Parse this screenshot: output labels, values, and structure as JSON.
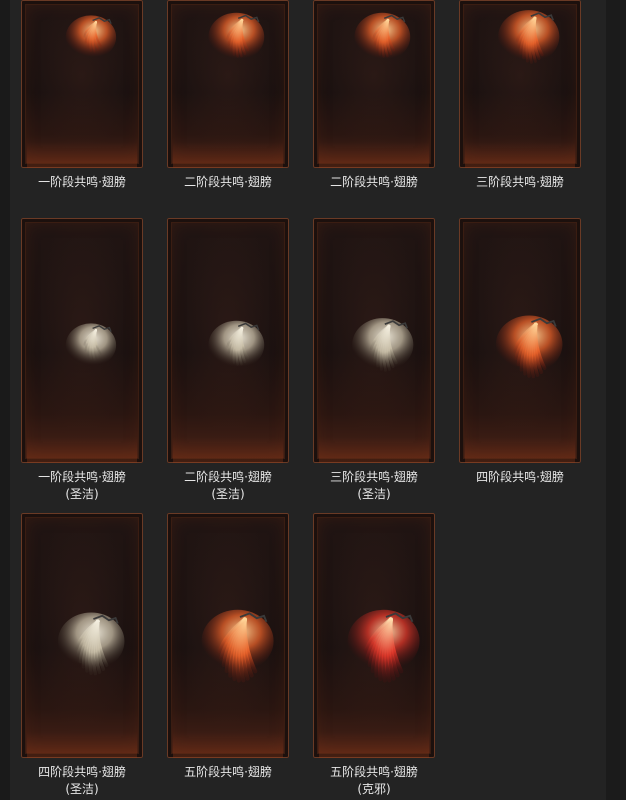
{
  "colors": {
    "fire_core": "#ffd79a",
    "fire_mid": "#e8622a",
    "fire_edge": "#7a1a0c",
    "holy_core": "#f4efe0",
    "holy_mid": "#c9bfa8",
    "holy_edge": "#4a4236",
    "evil_core": "#ffe2b0",
    "evil_mid": "#e0382a",
    "evil_edge": "#6a0c10"
  },
  "items": [
    {
      "title": "一阶段共鸣·翅膀",
      "subtitle": "",
      "icon": "wing-icon",
      "theme": "fire",
      "level": 1
    },
    {
      "title": "二阶段共鸣·翅膀",
      "subtitle": "",
      "icon": "wing-icon",
      "theme": "fire",
      "level": 2
    },
    {
      "title": "二阶段共鸣·翅膀",
      "subtitle": "",
      "icon": "wing-icon",
      "theme": "fire",
      "level": 2
    },
    {
      "title": "三阶段共鸣·翅膀",
      "subtitle": "",
      "icon": "wing-icon",
      "theme": "fire",
      "level": 3
    },
    {
      "title": "一阶段共鸣·翅膀",
      "subtitle": "(圣洁)",
      "icon": "wing-icon",
      "theme": "holy",
      "level": 1
    },
    {
      "title": "二阶段共鸣·翅膀",
      "subtitle": "(圣洁)",
      "icon": "wing-icon",
      "theme": "holy",
      "level": 2
    },
    {
      "title": "三阶段共鸣·翅膀",
      "subtitle": "(圣洁)",
      "icon": "wing-icon",
      "theme": "holy",
      "level": 3
    },
    {
      "title": "四阶段共鸣·翅膀",
      "subtitle": "",
      "icon": "wing-icon",
      "theme": "fire",
      "level": 4
    },
    {
      "title": "四阶段共鸣·翅膀",
      "subtitle": "(圣洁)",
      "icon": "wing-icon",
      "theme": "holy",
      "level": 4
    },
    {
      "title": "五阶段共鸣·翅膀",
      "subtitle": "",
      "icon": "wing-icon",
      "theme": "fire",
      "level": 5
    },
    {
      "title": "五阶段共鸣·翅膀",
      "subtitle": "(克邪)",
      "icon": "wing-icon",
      "theme": "evil",
      "level": 5
    }
  ]
}
